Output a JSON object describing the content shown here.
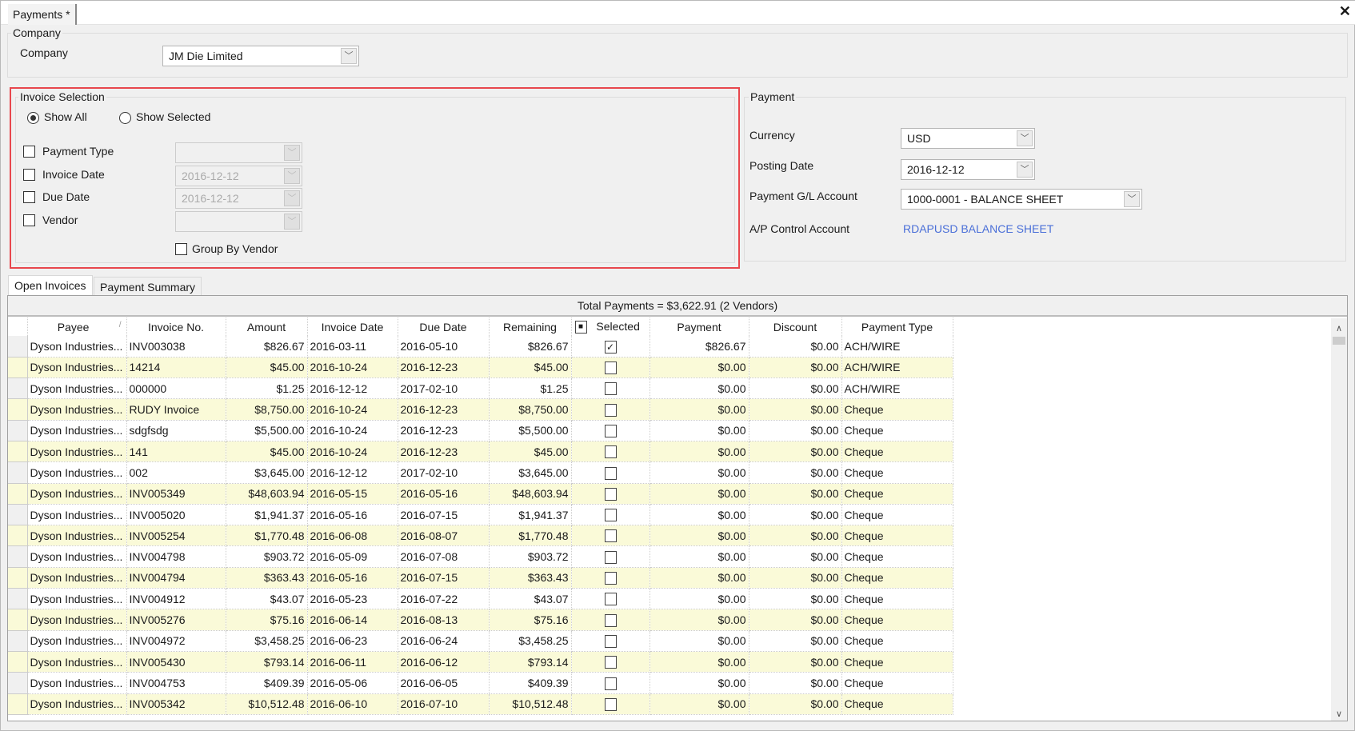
{
  "window": {
    "tab_label": "Payments *",
    "close_icon": "close-icon"
  },
  "company_group": {
    "title": "Company",
    "label": "Company",
    "value": "JM Die Limited"
  },
  "invoice_selection": {
    "title": "Invoice Selection",
    "show_all": "Show All",
    "show_selected": "Show Selected",
    "selected_radio": "Show All",
    "filters": [
      {
        "label": "Payment Type",
        "value": "",
        "checked": false
      },
      {
        "label": "Invoice Date",
        "value": "2016-12-12",
        "checked": false
      },
      {
        "label": "Due Date",
        "value": "2016-12-12",
        "checked": false
      },
      {
        "label": "Vendor",
        "value": "",
        "checked": false
      }
    ],
    "group_by_vendor": "Group By Vendor"
  },
  "payment": {
    "title": "Payment",
    "currency_label": "Currency",
    "currency": "USD",
    "posting_date_label": "Posting Date",
    "posting_date": "2016-12-12",
    "gl_label": "Payment G/L Account",
    "gl_account": "1000-0001 - BALANCE SHEET",
    "ap_label": "A/P Control Account",
    "ap_account": "RDAPUSD BALANCE SHEET"
  },
  "tabs": [
    "Open Invoices",
    "Payment Summary"
  ],
  "grid": {
    "total": "Total Payments = $3,622.91 (2 Vendors)",
    "columns": [
      "Payee",
      "Invoice No.",
      "Amount",
      "Invoice Date",
      "Due Date",
      "Remaining",
      "Selected",
      "Payment",
      "Discount",
      "Payment Type"
    ],
    "rows": [
      [
        "Dyson Industries...",
        "INV003038",
        "$826.67",
        "2016-03-11",
        "2016-05-10",
        "$826.67",
        true,
        "$826.67",
        "$0.00",
        "ACH/WIRE"
      ],
      [
        "Dyson Industries...",
        "14214",
        "$45.00",
        "2016-10-24",
        "2016-12-23",
        "$45.00",
        false,
        "$0.00",
        "$0.00",
        "ACH/WIRE"
      ],
      [
        "Dyson Industries...",
        "000000",
        "$1.25",
        "2016-12-12",
        "2017-02-10",
        "$1.25",
        false,
        "$0.00",
        "$0.00",
        "ACH/WIRE"
      ],
      [
        "Dyson Industries...",
        "RUDY Invoice",
        "$8,750.00",
        "2016-10-24",
        "2016-12-23",
        "$8,750.00",
        false,
        "$0.00",
        "$0.00",
        "Cheque"
      ],
      [
        "Dyson Industries...",
        "sdgfsdg",
        "$5,500.00",
        "2016-10-24",
        "2016-12-23",
        "$5,500.00",
        false,
        "$0.00",
        "$0.00",
        "Cheque"
      ],
      [
        "Dyson Industries...",
        "141",
        "$45.00",
        "2016-10-24",
        "2016-12-23",
        "$45.00",
        false,
        "$0.00",
        "$0.00",
        "Cheque"
      ],
      [
        "Dyson Industries...",
        "002",
        "$3,645.00",
        "2016-12-12",
        "2017-02-10",
        "$3,645.00",
        false,
        "$0.00",
        "$0.00",
        "Cheque"
      ],
      [
        "Dyson Industries...",
        "INV005349",
        "$48,603.94",
        "2016-05-15",
        "2016-05-16",
        "$48,603.94",
        false,
        "$0.00",
        "$0.00",
        "Cheque"
      ],
      [
        "Dyson Industries...",
        "INV005020",
        "$1,941.37",
        "2016-05-16",
        "2016-07-15",
        "$1,941.37",
        false,
        "$0.00",
        "$0.00",
        "Cheque"
      ],
      [
        "Dyson Industries...",
        "INV005254",
        "$1,770.48",
        "2016-06-08",
        "2016-08-07",
        "$1,770.48",
        false,
        "$0.00",
        "$0.00",
        "Cheque"
      ],
      [
        "Dyson Industries...",
        "INV004798",
        "$903.72",
        "2016-05-09",
        "2016-07-08",
        "$903.72",
        false,
        "$0.00",
        "$0.00",
        "Cheque"
      ],
      [
        "Dyson Industries...",
        "INV004794",
        "$363.43",
        "2016-05-16",
        "2016-07-15",
        "$363.43",
        false,
        "$0.00",
        "$0.00",
        "Cheque"
      ],
      [
        "Dyson Industries...",
        "INV004912",
        "$43.07",
        "2016-05-23",
        "2016-07-22",
        "$43.07",
        false,
        "$0.00",
        "$0.00",
        "Cheque"
      ],
      [
        "Dyson Industries...",
        "INV005276",
        "$75.16",
        "2016-06-14",
        "2016-08-13",
        "$75.16",
        false,
        "$0.00",
        "$0.00",
        "Cheque"
      ],
      [
        "Dyson Industries...",
        "INV004972",
        "$3,458.25",
        "2016-06-23",
        "2016-06-24",
        "$3,458.25",
        false,
        "$0.00",
        "$0.00",
        "Cheque"
      ],
      [
        "Dyson Industries...",
        "INV005430",
        "$793.14",
        "2016-06-11",
        "2016-06-12",
        "$793.14",
        false,
        "$0.00",
        "$0.00",
        "Cheque"
      ],
      [
        "Dyson Industries...",
        "INV004753",
        "$409.39",
        "2016-05-06",
        "2016-06-05",
        "$409.39",
        false,
        "$0.00",
        "$0.00",
        "Cheque"
      ],
      [
        "Dyson Industries...",
        "INV005342",
        "$10,512.48",
        "2016-06-10",
        "2016-07-10",
        "$10,512.48",
        false,
        "$0.00",
        "$0.00",
        "Cheque"
      ]
    ]
  },
  "colors": {
    "highlight_border": "#e8474d",
    "alt_row": "#fafad8",
    "link": "#4a6fd8"
  }
}
